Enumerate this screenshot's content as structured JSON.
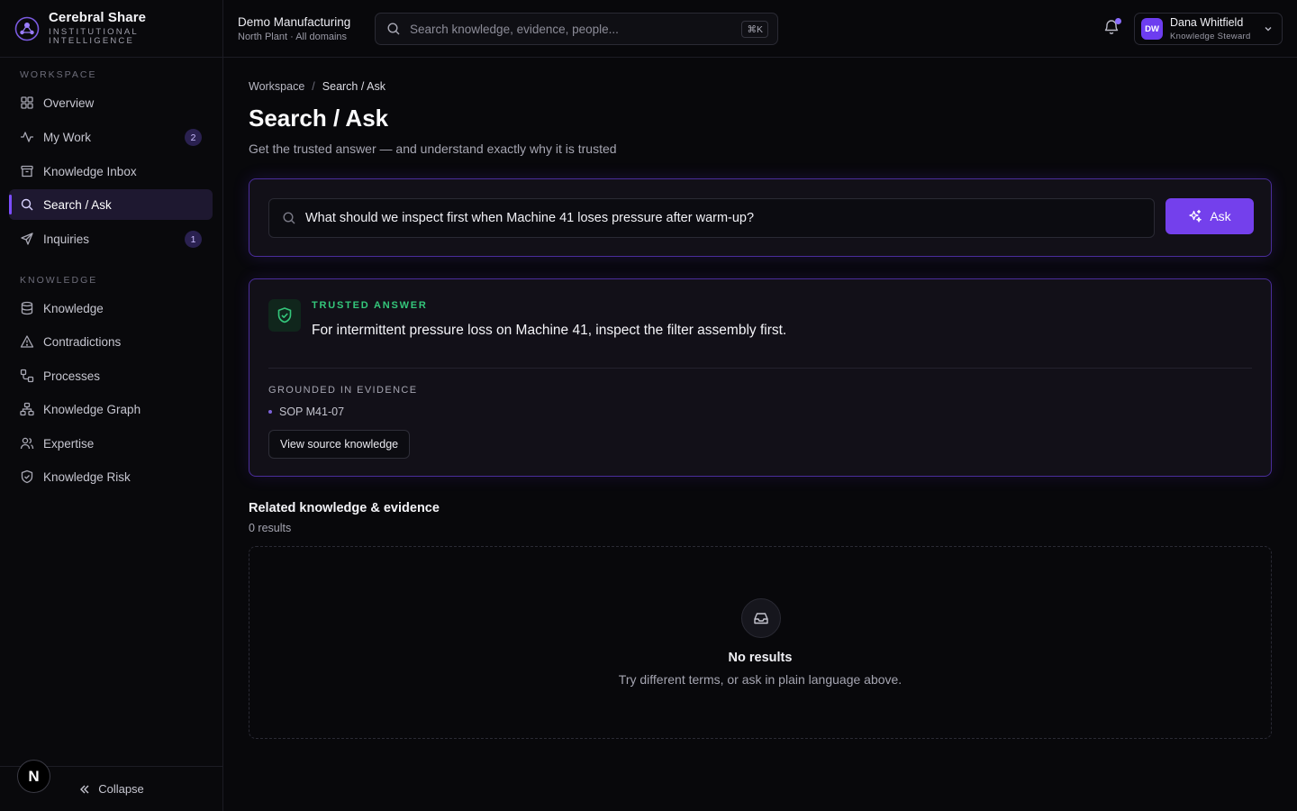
{
  "brand": {
    "name": "Cerebral Share",
    "subtitle": "INSTITUTIONAL INTELLIGENCE"
  },
  "sidebar": {
    "sections": [
      {
        "label": "WORKSPACE",
        "items": [
          {
            "label": "Overview",
            "icon": "grid-icon"
          },
          {
            "label": "My Work",
            "icon": "activity-icon",
            "badge": "2"
          },
          {
            "label": "Knowledge Inbox",
            "icon": "archive-icon"
          },
          {
            "label": "Search / Ask",
            "icon": "search-icon",
            "active": true
          },
          {
            "label": "Inquiries",
            "icon": "send-icon",
            "badge": "1"
          }
        ]
      },
      {
        "label": "KNOWLEDGE",
        "items": [
          {
            "label": "Knowledge",
            "icon": "database-icon"
          },
          {
            "label": "Contradictions",
            "icon": "warning-icon"
          },
          {
            "label": "Processes",
            "icon": "workflow-icon"
          },
          {
            "label": "Knowledge Graph",
            "icon": "graph-icon"
          },
          {
            "label": "Expertise",
            "icon": "users-icon"
          },
          {
            "label": "Knowledge Risk",
            "icon": "shield-icon"
          }
        ]
      }
    ],
    "collapse_label": "Collapse",
    "n_badge": "N"
  },
  "topbar": {
    "org_name": "Demo Manufacturing",
    "org_sub": "North Plant · All domains",
    "search_placeholder": "Search knowledge, evidence, people...",
    "search_shortcut": "⌘K",
    "user": {
      "initials": "DW",
      "name": "Dana Whitfield",
      "role": "Knowledge Steward"
    }
  },
  "main": {
    "breadcrumb": [
      "Workspace",
      "Search / Ask"
    ],
    "title": "Search / Ask",
    "subtitle": "Get the trusted answer — and understand exactly why it is trusted",
    "ask": {
      "query": "What should we inspect first when Machine 41 loses pressure after warm-up?",
      "button_label": "Ask"
    },
    "answer": {
      "label": "TRUSTED ANSWER",
      "text": "For intermittent pressure loss on Machine 41, inspect the filter assembly first.",
      "evidence_label": "GROUNDED IN EVIDENCE",
      "evidence": [
        "SOP M41-07"
      ],
      "source_button": "View source knowledge"
    },
    "related": {
      "title": "Related knowledge & evidence",
      "count": "0 results",
      "empty_title": "No results",
      "empty_sub": "Try different terms, or ask in plain language above."
    }
  },
  "colors": {
    "accent": "#7440ec",
    "trusted": "#34c77b",
    "background": "#08080b"
  }
}
